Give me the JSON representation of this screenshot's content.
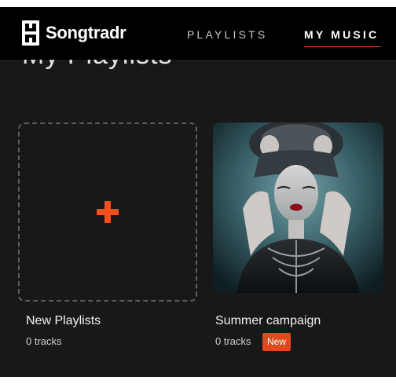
{
  "brand": {
    "name": "Songtradr",
    "accent_color": "#e2481c"
  },
  "nav": {
    "items": [
      {
        "label": "PLAYLISTS",
        "active": false
      },
      {
        "label": "MY MUSIC",
        "active": true
      }
    ]
  },
  "page": {
    "title": "My Playlists"
  },
  "playlists": [
    {
      "title": "New Playlists",
      "tracks": "0 tracks",
      "icon": "plus-icon"
    },
    {
      "title": "Summer campaign",
      "tracks": "0 tracks",
      "badge": "New",
      "image": "portrait-artwork"
    }
  ]
}
